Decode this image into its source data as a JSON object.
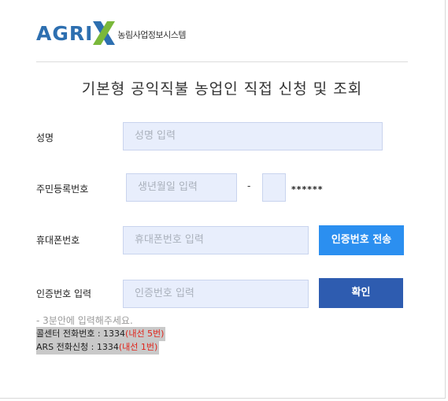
{
  "brand": {
    "logo_text": "AGRI",
    "logo_x": "X",
    "subtitle": "농림사업정보시스템",
    "colors": {
      "blue": "#2d6fb0",
      "green": "#7ab83a"
    }
  },
  "page": {
    "title": "기본형 공익직불 농업인 직접 신청 및 조회"
  },
  "form": {
    "name": {
      "label": "성명",
      "placeholder": "성명 입력"
    },
    "rrn": {
      "label": "주민등록번호",
      "front_placeholder": "생년월일 입력",
      "separator": "-",
      "back_value": "",
      "masked": "******"
    },
    "phone": {
      "label": "휴대폰번호",
      "placeholder": "휴대폰번호 입력",
      "button": "인증번호 전송"
    },
    "auth": {
      "label": "인증번호 입력",
      "placeholder": "인증번호 입력",
      "button": "확인"
    }
  },
  "notice": {
    "hint": "- 3분안에 입력해주세요.",
    "call_center": {
      "text": "콜센터 전화번호 : 1334",
      "ext": "(내선 5번)"
    },
    "ars": {
      "text": "ARS 전화신청 : 1334",
      "ext": "(내선 1번)"
    }
  },
  "colors": {
    "input_bg": "#e8eefc",
    "send_button": "#2b8ff0",
    "confirm_button": "#2e5cb0",
    "ext_red": "#e0251c"
  }
}
